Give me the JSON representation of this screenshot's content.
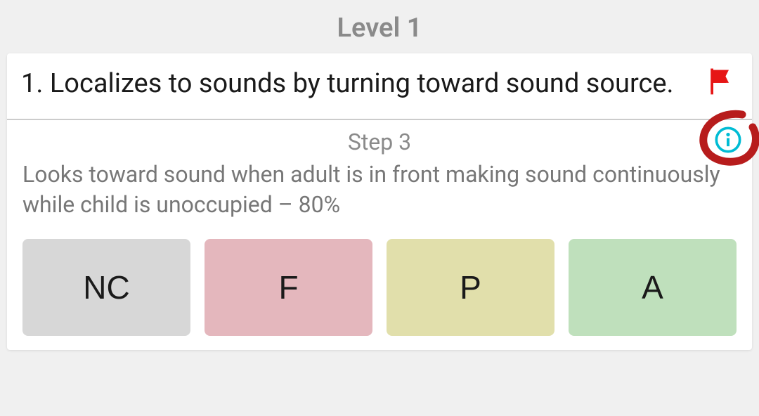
{
  "header": {
    "level_label": "Level 1"
  },
  "question": {
    "number_prefix": "1. ",
    "text": "Localizes to sounds by turning toward sound source."
  },
  "step": {
    "label": "Step 3",
    "description": "Looks toward sound when adult is in front making sound continuously while child is unoccupied  – 80%"
  },
  "buttons": {
    "nc": "NC",
    "f": "F",
    "p": "P",
    "a": "A"
  },
  "icons": {
    "flag_color": "#e61616",
    "info_color": "#00bcd4",
    "circle_color": "#b71c1c"
  }
}
